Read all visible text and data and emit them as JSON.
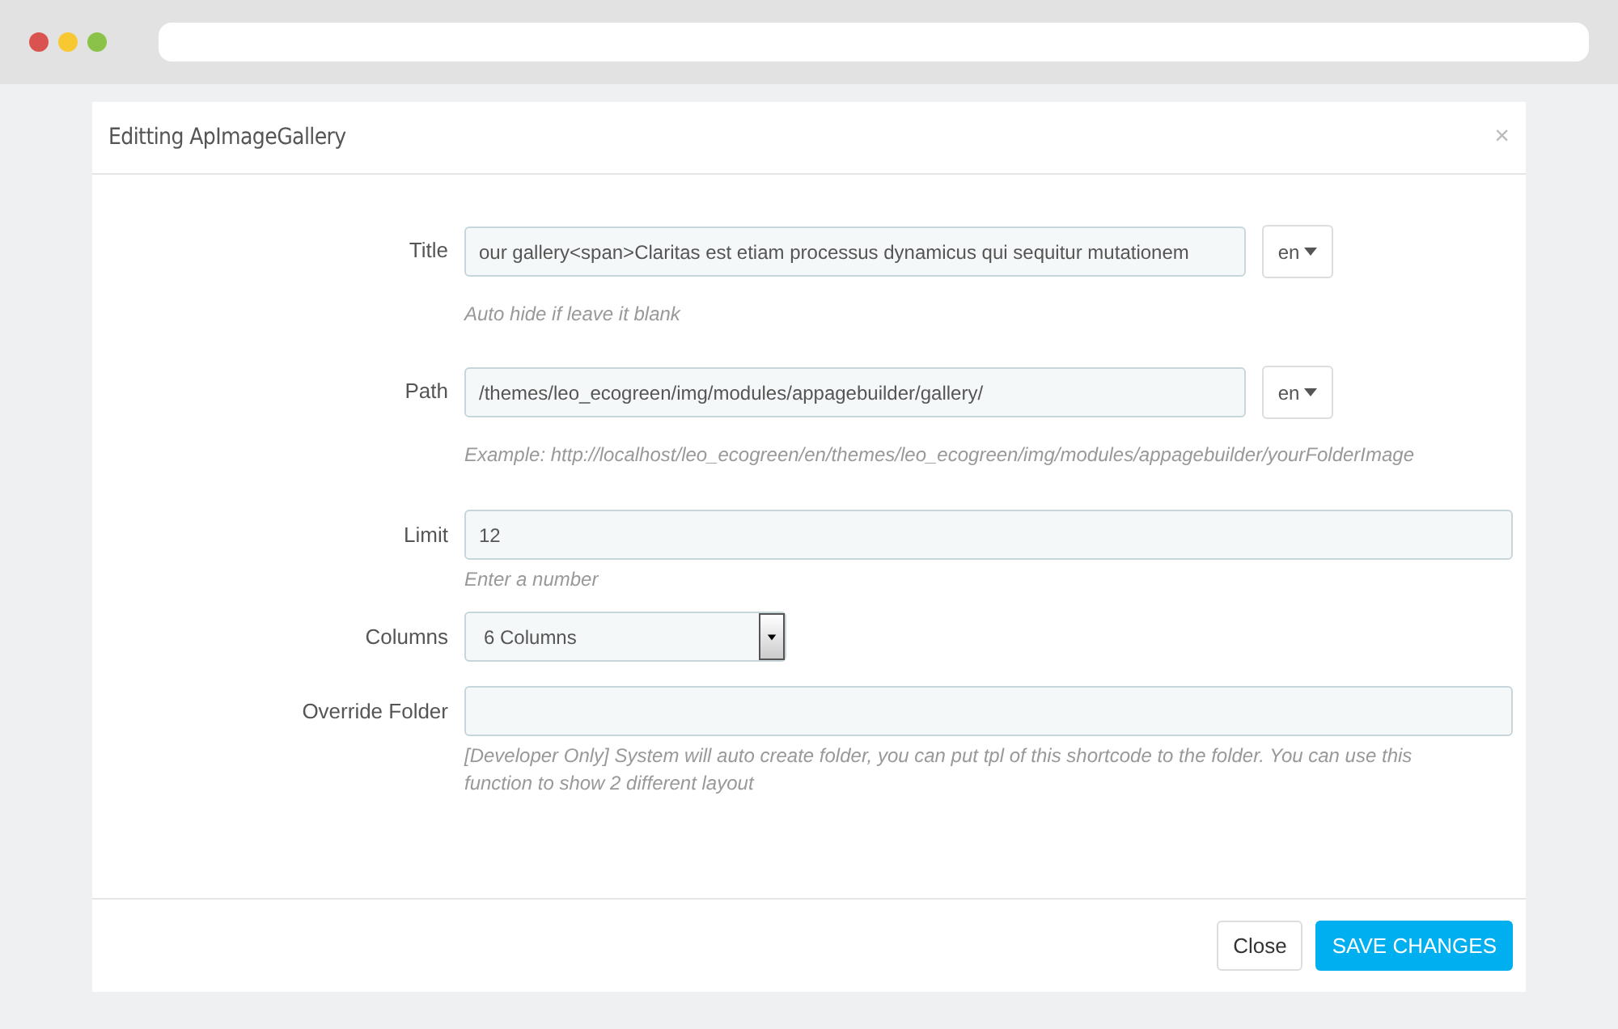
{
  "modal": {
    "title": "Editting ApImageGallery",
    "close": "×"
  },
  "fields": [
    {
      "kind": "lang",
      "label": "Title",
      "value": "our gallery<span>Claritas est etiam processus dynamicus qui sequitur mutationem",
      "lang": "en",
      "help": "Auto hide if leave it blank"
    },
    {
      "kind": "lang",
      "label": "Path",
      "value": "/themes/leo_ecogreen/img/modules/appagebuilder/gallery/",
      "lang": "en",
      "help": "Example: http://localhost/leo_ecogreen/en/themes/leo_ecogreen/img/modules/appagebuilder/yourFolderImage"
    },
    {
      "kind": "text",
      "label": "Limit",
      "value": "12",
      "help": "Enter a number"
    },
    {
      "kind": "select",
      "label": "Columns",
      "value": "6 Columns"
    },
    {
      "kind": "text",
      "label": "Override Folder",
      "help": "[Developer Only] System will auto create folder, you can put tpl of this shortcode to the folder. You can use this function to show 2 different layout"
    }
  ],
  "buttons": [
    {
      "kind": "default",
      "label": "Close"
    },
    {
      "kind": "primary",
      "label": "SAVE CHANGES"
    }
  ]
}
